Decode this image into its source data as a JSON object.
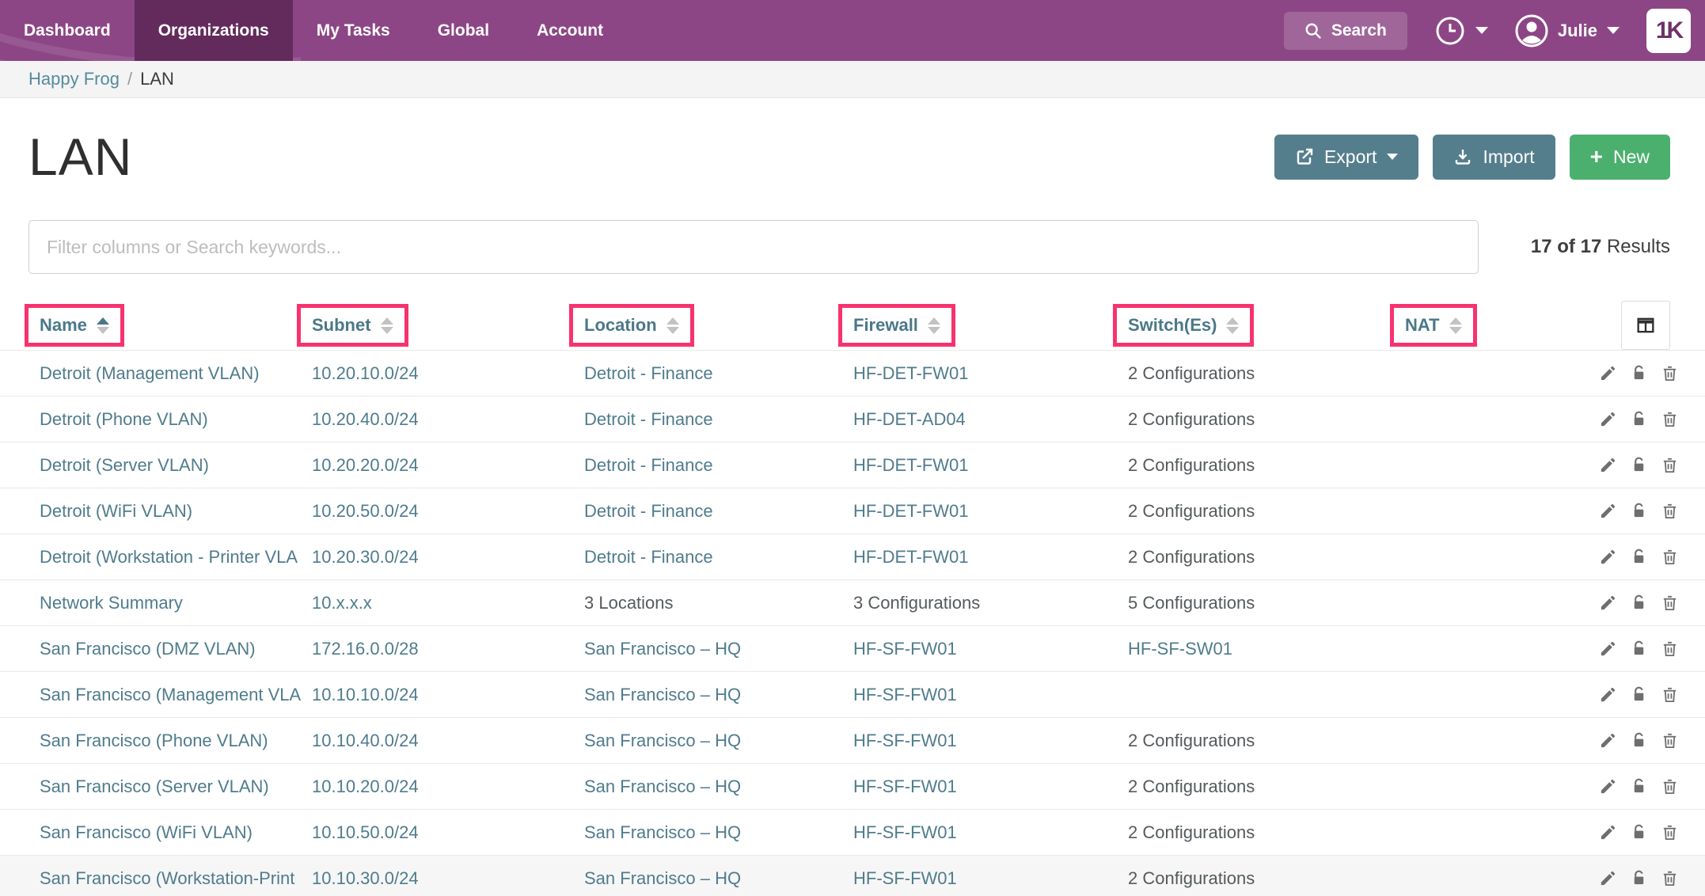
{
  "nav": {
    "items": [
      {
        "label": "Dashboard",
        "active": false
      },
      {
        "label": "Organizations",
        "active": true
      },
      {
        "label": "My Tasks",
        "active": false
      },
      {
        "label": "Global",
        "active": false
      },
      {
        "label": "Account",
        "active": false
      }
    ],
    "search_label": "Search",
    "user_name": "Julie",
    "logo_text": "1K"
  },
  "breadcrumb": {
    "org": "Happy Frog",
    "sep": "/",
    "page": "LAN"
  },
  "page": {
    "title": "LAN"
  },
  "toolbar": {
    "export_label": "Export",
    "import_label": "Import",
    "new_label": "New"
  },
  "filter": {
    "placeholder": "Filter columns or Search keywords..."
  },
  "results": {
    "count": "17 of 17",
    "suffix": "Results"
  },
  "colors": {
    "nav_purple": "#8d4685",
    "nav_active_purple": "#632b5c",
    "button_teal": "#557e8d",
    "button_green": "#4bb06e",
    "link_teal": "#4f7c8c",
    "annotation_pink": "#f7336f"
  },
  "table": {
    "columns": [
      {
        "label": "Name",
        "sort": "asc"
      },
      {
        "label": "Subnet",
        "sort": "none"
      },
      {
        "label": "Location",
        "sort": "none"
      },
      {
        "label": "Firewall",
        "sort": "none"
      },
      {
        "label": "Switch(Es)",
        "sort": "none"
      },
      {
        "label": "NAT",
        "sort": "none"
      }
    ],
    "rows": [
      {
        "highlight": false,
        "cells": [
          {
            "t": "Detroit (Management VLAN)",
            "link": true
          },
          {
            "t": "10.20.10.0/24",
            "link": true
          },
          {
            "t": "Detroit - Finance",
            "link": true
          },
          {
            "t": "HF-DET-FW01",
            "link": true
          },
          {
            "t": "2 Configurations",
            "link": false
          },
          {
            "t": "",
            "link": false
          }
        ]
      },
      {
        "highlight": false,
        "cells": [
          {
            "t": "Detroit (Phone VLAN)",
            "link": true
          },
          {
            "t": "10.20.40.0/24",
            "link": true
          },
          {
            "t": "Detroit - Finance",
            "link": true
          },
          {
            "t": "HF-DET-AD04",
            "link": true
          },
          {
            "t": "2 Configurations",
            "link": false
          },
          {
            "t": "",
            "link": false
          }
        ]
      },
      {
        "highlight": false,
        "cells": [
          {
            "t": "Detroit (Server VLAN)",
            "link": true
          },
          {
            "t": "10.20.20.0/24",
            "link": true
          },
          {
            "t": "Detroit - Finance",
            "link": true
          },
          {
            "t": "HF-DET-FW01",
            "link": true
          },
          {
            "t": "2 Configurations",
            "link": false
          },
          {
            "t": "",
            "link": false
          }
        ]
      },
      {
        "highlight": false,
        "cells": [
          {
            "t": "Detroit (WiFi VLAN)",
            "link": true
          },
          {
            "t": "10.20.50.0/24",
            "link": true
          },
          {
            "t": "Detroit - Finance",
            "link": true
          },
          {
            "t": "HF-DET-FW01",
            "link": true
          },
          {
            "t": "2 Configurations",
            "link": false
          },
          {
            "t": "",
            "link": false
          }
        ]
      },
      {
        "highlight": false,
        "cells": [
          {
            "t": "Detroit (Workstation - Printer VLA",
            "link": true
          },
          {
            "t": "10.20.30.0/24",
            "link": true
          },
          {
            "t": "Detroit - Finance",
            "link": true
          },
          {
            "t": "HF-DET-FW01",
            "link": true
          },
          {
            "t": "2 Configurations",
            "link": false
          },
          {
            "t": "",
            "link": false
          }
        ]
      },
      {
        "highlight": false,
        "cells": [
          {
            "t": "Network Summary",
            "link": true
          },
          {
            "t": "10.x.x.x",
            "link": true
          },
          {
            "t": "3 Locations",
            "link": false
          },
          {
            "t": "3 Configurations",
            "link": false
          },
          {
            "t": "5 Configurations",
            "link": false
          },
          {
            "t": "",
            "link": false
          }
        ]
      },
      {
        "highlight": false,
        "cells": [
          {
            "t": "San Francisco (DMZ VLAN)",
            "link": true
          },
          {
            "t": "172.16.0.0/28",
            "link": true
          },
          {
            "t": "San Francisco – HQ",
            "link": true
          },
          {
            "t": "HF-SF-FW01",
            "link": true
          },
          {
            "t": "HF-SF-SW01",
            "link": true
          },
          {
            "t": "",
            "link": false
          }
        ]
      },
      {
        "highlight": false,
        "cells": [
          {
            "t": "San Francisco (Management VLA",
            "link": true
          },
          {
            "t": "10.10.10.0/24",
            "link": true
          },
          {
            "t": "San Francisco – HQ",
            "link": true
          },
          {
            "t": "HF-SF-FW01",
            "link": true
          },
          {
            "t": "",
            "link": false
          },
          {
            "t": "",
            "link": false
          }
        ]
      },
      {
        "highlight": false,
        "cells": [
          {
            "t": "San Francisco (Phone VLAN)",
            "link": true
          },
          {
            "t": "10.10.40.0/24",
            "link": true
          },
          {
            "t": "San Francisco – HQ",
            "link": true
          },
          {
            "t": "HF-SF-FW01",
            "link": true
          },
          {
            "t": "2 Configurations",
            "link": false
          },
          {
            "t": "",
            "link": false
          }
        ]
      },
      {
        "highlight": false,
        "cells": [
          {
            "t": "San Francisco (Server VLAN)",
            "link": true
          },
          {
            "t": "10.10.20.0/24",
            "link": true
          },
          {
            "t": "San Francisco – HQ",
            "link": true
          },
          {
            "t": "HF-SF-FW01",
            "link": true
          },
          {
            "t": "2 Configurations",
            "link": false
          },
          {
            "t": "",
            "link": false
          }
        ]
      },
      {
        "highlight": false,
        "cells": [
          {
            "t": "San Francisco (WiFi VLAN)",
            "link": true
          },
          {
            "t": "10.10.50.0/24",
            "link": true
          },
          {
            "t": "San Francisco – HQ",
            "link": true
          },
          {
            "t": "HF-SF-FW01",
            "link": true
          },
          {
            "t": "2 Configurations",
            "link": false
          },
          {
            "t": "",
            "link": false
          }
        ]
      },
      {
        "highlight": true,
        "cells": [
          {
            "t": "San Francisco (Workstation-Print",
            "link": true
          },
          {
            "t": "10.10.30.0/24",
            "link": true
          },
          {
            "t": "San Francisco – HQ",
            "link": true
          },
          {
            "t": "HF-SF-FW01",
            "link": true
          },
          {
            "t": "2 Configurations",
            "link": false
          },
          {
            "t": "",
            "link": false
          }
        ]
      }
    ]
  }
}
